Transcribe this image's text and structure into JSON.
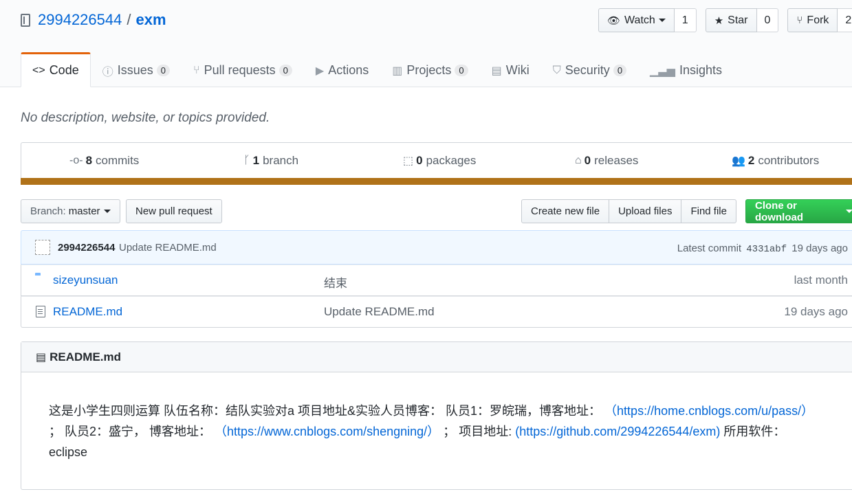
{
  "repo": {
    "owner": "2994226544",
    "separator": "/",
    "name": "exm"
  },
  "actions": {
    "watch": {
      "label": "Watch",
      "count": "1",
      "icon": "eye-icon"
    },
    "star": {
      "label": "Star",
      "count": "0",
      "icon": "star-icon"
    },
    "fork": {
      "label": "Fork",
      "count": "2",
      "icon": "fork-icon"
    }
  },
  "tabs": [
    {
      "label": "Code",
      "icon": "code-icon",
      "count": null
    },
    {
      "label": "Issues",
      "icon": "issue-icon",
      "count": "0"
    },
    {
      "label": "Pull requests",
      "icon": "pull-request-icon",
      "count": "0"
    },
    {
      "label": "Actions",
      "icon": "play-icon",
      "count": null
    },
    {
      "label": "Projects",
      "icon": "project-icon",
      "count": "0"
    },
    {
      "label": "Wiki",
      "icon": "book-icon",
      "count": null
    },
    {
      "label": "Security",
      "icon": "shield-icon",
      "count": "0"
    },
    {
      "label": "Insights",
      "icon": "graph-icon",
      "count": null
    }
  ],
  "description": "No description, website, or topics provided.",
  "summary": {
    "commits": {
      "num": "8",
      "label": "commits"
    },
    "branches": {
      "num": "1",
      "label": "branch"
    },
    "packages": {
      "num": "0",
      "label": "packages"
    },
    "releases": {
      "num": "0",
      "label": "releases"
    },
    "contributors": {
      "num": "2",
      "label": "contributors"
    },
    "language_color": "#b07219"
  },
  "file_nav": {
    "branch_prefix": "Branch:",
    "branch": "master",
    "new_pr": "New pull request",
    "create_file": "Create new file",
    "upload_files": "Upload files",
    "find_file": "Find file",
    "clone": "Clone or download"
  },
  "latest_commit": {
    "author": "2994226544",
    "message": "Update README.md",
    "prefix": "Latest commit",
    "sha": "4331abf",
    "age": "19 days ago"
  },
  "files": [
    {
      "type": "folder",
      "name": "sizeyunsuan",
      "message": "结束",
      "age": "last month"
    },
    {
      "type": "file",
      "name": "README.md",
      "message": "Update README.md",
      "age": "19 days ago"
    }
  ],
  "readme": {
    "title": "README.md",
    "text1": "这是小学生四则运算 队伍名称：结队实验对a 项目地址&实验人员博客： 队员1：罗皖瑞，博客地址：",
    "link1": "（https://home.cnblogs.com/u/pass/）",
    "text2": "； 队员2：盛宁， 博客地址：",
    "link2": "（https://www.cnblogs.com/shengning/）",
    "text3": "； 项目地址:",
    "link3": "(https://github.com/2994226544/exm)",
    "text4": " 所用软件： eclipse"
  }
}
